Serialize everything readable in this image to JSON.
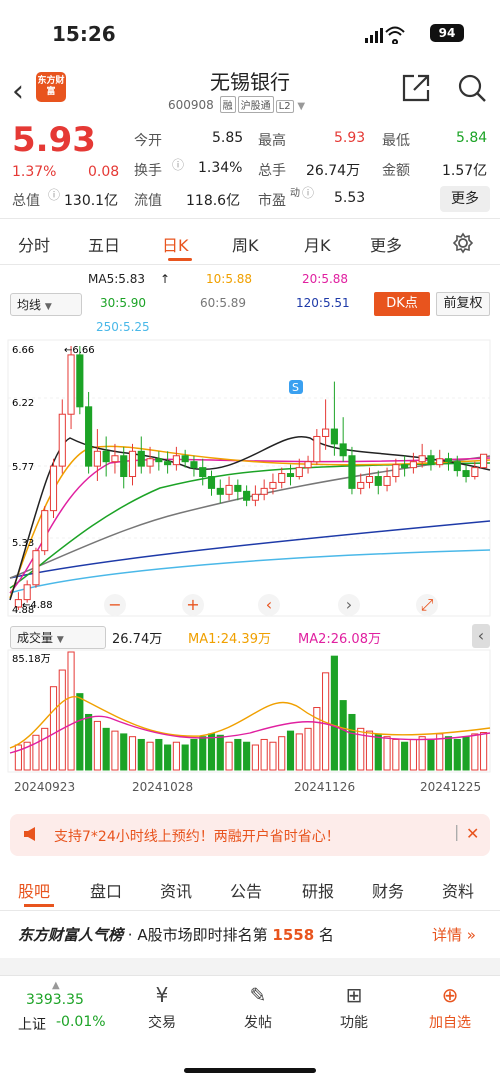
{
  "status_bar": {
    "time": "15:26",
    "battery": "94"
  },
  "header": {
    "logo_text": "东方财富",
    "title": "无锡银行",
    "code": "600908",
    "tags": [
      "融",
      "沪股通",
      "L2"
    ]
  },
  "quote": {
    "price": "5.93",
    "change_pct": "1.37%",
    "change": "0.08",
    "fields": {
      "open_label": "今开",
      "open": "5.85",
      "high_label": "最高",
      "high": "5.93",
      "low_label": "最低",
      "low": "5.84",
      "turnover_label": "换手",
      "turnover": "1.34%",
      "volume_label": "总手",
      "volume": "26.74万",
      "amount_label": "金额",
      "amount": "1.57亿",
      "mktcap_label": "总值",
      "mktcap": "130.1亿",
      "float_label": "流值",
      "float": "118.6亿",
      "pe_label": "市盈",
      "pe_sup": "动",
      "pe": "5.53"
    },
    "more_label": "更多"
  },
  "tabs": [
    "分时",
    "五日",
    "日K",
    "周K",
    "月K",
    "更多"
  ],
  "ma": {
    "ma5": "MA5:5.83",
    "ma10": "10:5.88",
    "ma20": "20:5.88",
    "ma30": "30:5.90",
    "ma60": "60:5.89",
    "ma120": "120:5.51",
    "ma250": "250:5.25",
    "indicator_select": "均线",
    "dk_label": "DK点",
    "adjust_label": "前复权"
  },
  "chart_axes": {
    "y_top": "6.66",
    "y_mid": "6.22",
    "y_5": "5.77",
    "y_4": "5.33",
    "y_bottom": "4.88",
    "max_note": "←6.66",
    "min_note": "←4.88",
    "dates": [
      "20240923",
      "20241028",
      "20241126",
      "20241225"
    ]
  },
  "volume": {
    "select": "成交量",
    "value": "26.74万",
    "ma1": "MA1:24.39万",
    "ma2": "MA2:26.08万",
    "max": "85.18万"
  },
  "chart_data": {
    "type": "candlestick",
    "ylim": [
      4.88,
      6.66
    ],
    "candles": [
      [
        4.9,
        4.95,
        4.88,
        5.0
      ],
      [
        4.95,
        5.05,
        4.93,
        5.08
      ],
      [
        5.05,
        5.28,
        5.03,
        5.3
      ],
      [
        5.28,
        5.55,
        5.25,
        5.58
      ],
      [
        5.55,
        5.85,
        5.5,
        5.9
      ],
      [
        5.85,
        6.2,
        5.8,
        6.3
      ],
      [
        6.2,
        6.6,
        6.1,
        6.66
      ],
      [
        6.6,
        6.25,
        6.2,
        6.66
      ],
      [
        6.25,
        5.85,
        5.8,
        6.35
      ],
      [
        5.85,
        5.95,
        5.75,
        6.1
      ],
      [
        5.95,
        5.88,
        5.78,
        6.05
      ],
      [
        5.88,
        5.92,
        5.8,
        6.0
      ],
      [
        5.92,
        5.78,
        5.7,
        5.98
      ],
      [
        5.78,
        5.95,
        5.72,
        6.0
      ],
      [
        5.95,
        5.85,
        5.8,
        6.05
      ],
      [
        5.85,
        5.9,
        5.8,
        5.98
      ],
      [
        5.9,
        5.88,
        5.82,
        5.95
      ],
      [
        5.88,
        5.86,
        5.8,
        5.95
      ],
      [
        5.86,
        5.92,
        5.82,
        5.98
      ],
      [
        5.92,
        5.88,
        5.84,
        5.96
      ],
      [
        5.88,
        5.84,
        5.78,
        5.92
      ],
      [
        5.84,
        5.78,
        5.72,
        5.9
      ],
      [
        5.78,
        5.7,
        5.65,
        5.82
      ],
      [
        5.7,
        5.66,
        5.6,
        5.76
      ],
      [
        5.66,
        5.72,
        5.62,
        5.78
      ],
      [
        5.72,
        5.68,
        5.62,
        5.76
      ],
      [
        5.68,
        5.62,
        5.58,
        5.72
      ],
      [
        5.62,
        5.66,
        5.58,
        5.72
      ],
      [
        5.66,
        5.7,
        5.62,
        5.76
      ],
      [
        5.7,
        5.74,
        5.66,
        5.8
      ],
      [
        5.74,
        5.8,
        5.7,
        5.84
      ],
      [
        5.8,
        5.78,
        5.72,
        5.86
      ],
      [
        5.78,
        5.84,
        5.76,
        5.9
      ],
      [
        5.84,
        5.88,
        5.8,
        5.92
      ],
      [
        5.88,
        6.05,
        5.86,
        6.1
      ],
      [
        6.05,
        6.1,
        5.96,
        6.3
      ],
      [
        6.1,
        6.0,
        5.92,
        6.42
      ],
      [
        6.0,
        5.92,
        5.88,
        6.18
      ],
      [
        5.92,
        5.7,
        5.66,
        5.98
      ],
      [
        5.7,
        5.74,
        5.66,
        5.8
      ],
      [
        5.74,
        5.78,
        5.7,
        5.84
      ],
      [
        5.78,
        5.72,
        5.66,
        5.82
      ],
      [
        5.72,
        5.78,
        5.68,
        5.84
      ],
      [
        5.78,
        5.86,
        5.74,
        5.9
      ],
      [
        5.86,
        5.84,
        5.78,
        5.92
      ],
      [
        5.84,
        5.88,
        5.8,
        5.94
      ],
      [
        5.88,
        5.92,
        5.84,
        6.0
      ],
      [
        5.92,
        5.86,
        5.82,
        5.96
      ],
      [
        5.86,
        5.9,
        5.84,
        5.96
      ],
      [
        5.9,
        5.88,
        5.82,
        5.94
      ],
      [
        5.88,
        5.82,
        5.78,
        5.92
      ],
      [
        5.82,
        5.78,
        5.74,
        5.86
      ],
      [
        5.78,
        5.84,
        5.76,
        5.88
      ],
      [
        5.84,
        5.93,
        5.84,
        5.93
      ]
    ],
    "volumes": [
      18,
      20,
      25,
      30,
      60,
      72,
      85,
      55,
      40,
      35,
      30,
      28,
      26,
      24,
      22,
      20,
      22,
      18,
      20,
      18,
      22,
      24,
      26,
      25,
      20,
      22,
      20,
      18,
      22,
      20,
      24,
      28,
      26,
      30,
      45,
      70,
      82,
      50,
      40,
      30,
      28,
      26,
      24,
      22,
      20,
      22,
      24,
      22,
      26,
      24,
      22,
      24,
      26,
      27
    ]
  },
  "chart_controls": [
    "−",
    "+",
    "‹",
    "›",
    "⤢"
  ],
  "promo": "支持7*24小时线上预约！两融开户省时省心！",
  "bottom_tabs": [
    "股吧",
    "盘口",
    "资讯",
    "公告",
    "研报",
    "财务",
    "资料"
  ],
  "rank": {
    "brand": "东方财富人气榜",
    "text": "· A股市场即时排名第",
    "number": "1558",
    "unit": "名",
    "detail": "详情"
  },
  "footer": {
    "index_value": "3393.35",
    "index_name": "上证",
    "index_change": "-0.01%",
    "items": [
      {
        "label": "交易",
        "icon": "trade-icon"
      },
      {
        "label": "发帖",
        "icon": "post-icon"
      },
      {
        "label": "功能",
        "icon": "apps-icon"
      },
      {
        "label": "加自选",
        "icon": "add-favorite-icon"
      }
    ]
  }
}
